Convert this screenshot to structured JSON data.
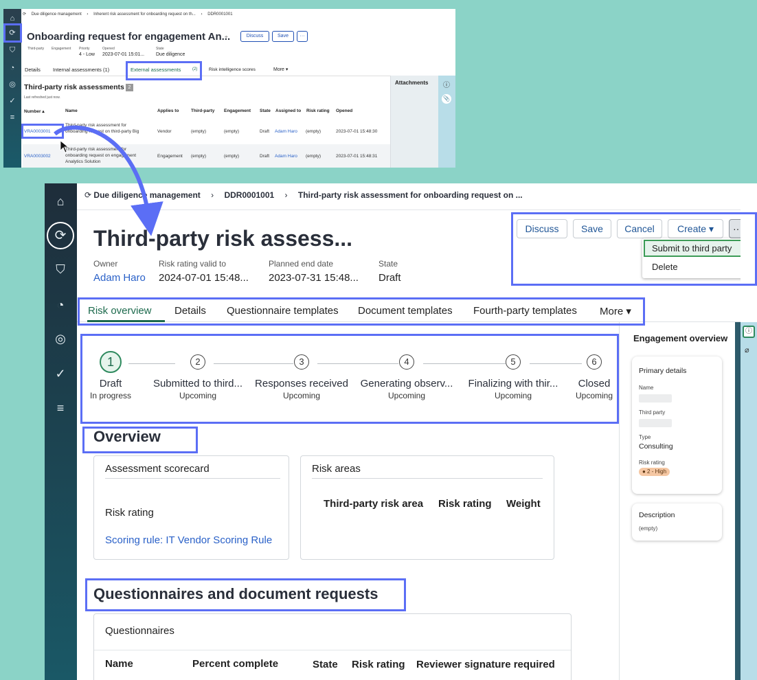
{
  "top": {
    "breadcrumb": [
      "Due diligence management",
      "›",
      "Inherent risk assessment for onboarding request on th...",
      "›",
      "DDR0001001"
    ],
    "title": "Onboarding request for engagement An...",
    "buttons": {
      "discuss": "Discuss",
      "save": "Save",
      "more": "···"
    },
    "meta": [
      {
        "label": "Third-party",
        "value": ""
      },
      {
        "label": "Engagement",
        "value": ""
      },
      {
        "label": "Priority",
        "value": "4 - Low"
      },
      {
        "label": "Opened",
        "value": "2023-07-01 15:01..."
      },
      {
        "label": "State",
        "value": "Due diligence"
      }
    ],
    "tabs": [
      "Details",
      "Internal assessments (1)",
      "External assessments",
      "(2)",
      "Risk intelligence scores",
      "More ▾"
    ],
    "section_title": "Third-party risk assessments",
    "section_count": "2",
    "refreshed": "Last refreshed just now.",
    "columns": [
      "Number ▴",
      "Name",
      "Applies to",
      "Third-party",
      "Engagement",
      "State",
      "Assigned to",
      "Risk rating",
      "Opened"
    ],
    "rows": [
      {
        "number": "VRA0003001",
        "name": [
          "Third-party risk assessment for",
          "onboarding request on third-party Big"
        ],
        "applies_to": "Vendor",
        "third_party": "(empty)",
        "engagement": "(empty)",
        "state": "Draft",
        "assigned_to": "Adam Haro",
        "risk_rating": "(empty)",
        "opened": "2023-07-01 15:48:30"
      },
      {
        "number": "VRA0003002",
        "name": [
          "Third-party risk assessment for",
          "onboarding request on engagement",
          "Analytics Solution"
        ],
        "applies_to": "Engagement",
        "third_party": "(empty)",
        "engagement": "(empty)",
        "state": "Draft",
        "assigned_to": "Adam Haro",
        "risk_rating": "(empty)",
        "opened": "2023-07-01 15:48:31"
      }
    ],
    "attachments": "Attachments",
    "info_icon": "ⓘ",
    "paperclip_icon": "📎"
  },
  "main": {
    "breadcrumb": {
      "item1": "Due diligence management",
      "item2": "DDR0001001",
      "item3": "Third-party risk assessment for onboarding request on ...",
      "sep": "›"
    },
    "title": "Third-party risk assess...",
    "meta": [
      {
        "label": "Owner",
        "value": "Adam Haro"
      },
      {
        "label": "Risk rating valid to",
        "value": "2024-07-01 15:48..."
      },
      {
        "label": "Planned end date",
        "value": "2023-07-31 15:48..."
      },
      {
        "label": "State",
        "value": "Draft"
      }
    ],
    "buttons": {
      "discuss": "Discuss",
      "save": "Save",
      "cancel": "Cancel",
      "create": "Create ▾",
      "more": "···"
    },
    "dropdown": [
      "Submit to third party",
      "Delete"
    ],
    "tabs": [
      "Risk overview",
      "Details",
      "Questionnaire templates",
      "Document templates",
      "Fourth-party templates",
      "More ▾"
    ],
    "steps": [
      {
        "num": "1",
        "name": "Draft",
        "status": "In progress"
      },
      {
        "num": "2",
        "name": "Submitted to third...",
        "status": "Upcoming"
      },
      {
        "num": "3",
        "name": "Responses received",
        "status": "Upcoming"
      },
      {
        "num": "4",
        "name": "Generating observ...",
        "status": "Upcoming"
      },
      {
        "num": "5",
        "name": "Finalizing with thir...",
        "status": "Upcoming"
      },
      {
        "num": "6",
        "name": "Closed",
        "status": "Upcoming"
      }
    ],
    "overview_title": "Overview",
    "scorecard": {
      "title": "Assessment scorecard",
      "risk_rating": "Risk rating",
      "scoring_rule": "Scoring rule: IT Vendor Scoring Rule"
    },
    "risk_areas": {
      "title": "Risk areas",
      "columns": [
        "Third-party risk area",
        "Risk rating",
        "Weight"
      ]
    },
    "questionnaires_title": "Questionnaires and document requests",
    "questionnaires": {
      "title": "Questionnaires",
      "columns": [
        "Name",
        "Percent complete",
        "State",
        "Risk rating",
        "Reviewer signature required"
      ]
    },
    "engagement": {
      "title": "Engagement overview",
      "primary": "Primary details",
      "name_label": "Name",
      "third_party_label": "Third party",
      "type_label": "Type",
      "type_value": "Consulting",
      "risk_label": "Risk rating",
      "risk_value": "● 2 - High",
      "desc_title": "Description",
      "desc_value": "(empty)"
    },
    "info_icon": "ⓘ",
    "paperclip_icon": "⌀"
  },
  "colors": {
    "highlight": "#5b6ef5",
    "active_green": "#1d6a4d",
    "link_blue": "#2a61c8",
    "background": "#8bd3c7"
  }
}
